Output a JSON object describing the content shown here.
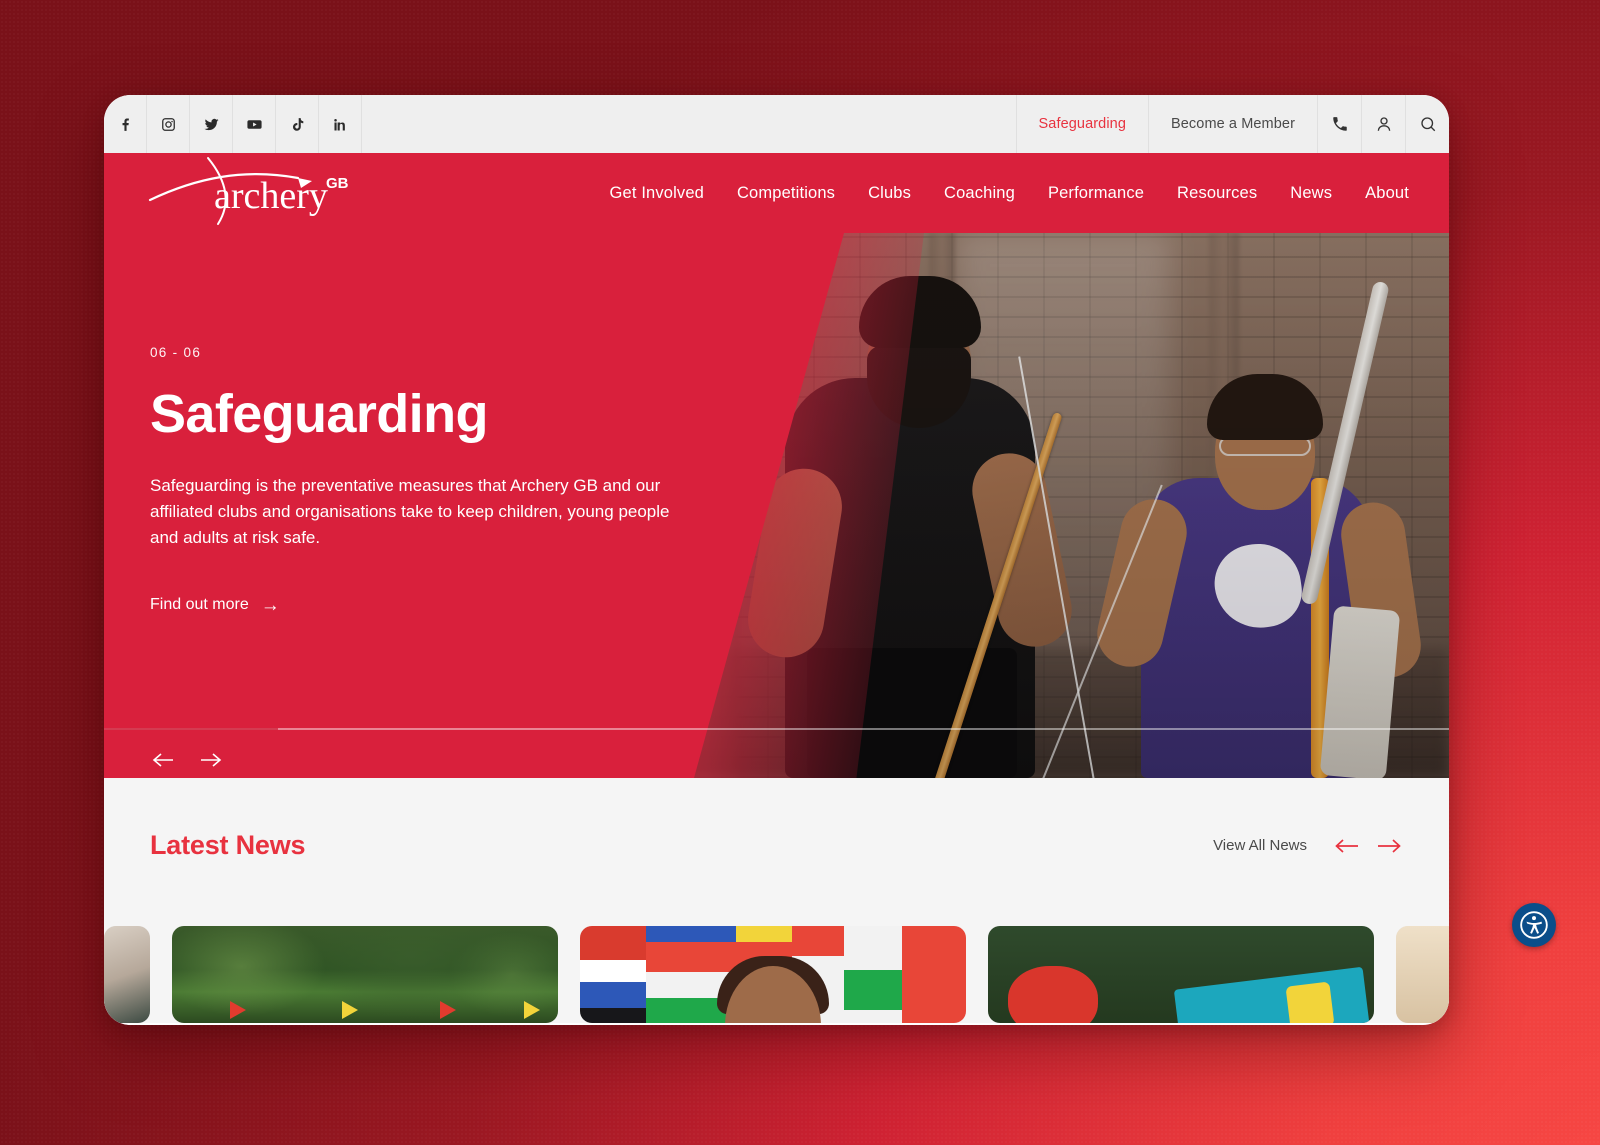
{
  "utility_bar": {
    "social": [
      {
        "name": "facebook-icon",
        "label": "Facebook"
      },
      {
        "name": "instagram-icon",
        "label": "Instagram"
      },
      {
        "name": "twitter-icon",
        "label": "Twitter"
      },
      {
        "name": "youtube-icon",
        "label": "YouTube"
      },
      {
        "name": "tiktok-icon",
        "label": "TikTok"
      },
      {
        "name": "linkedin-icon",
        "label": "LinkedIn"
      }
    ],
    "safeguarding_label": "Safeguarding",
    "become_member_label": "Become a Member",
    "phone_icon": "phone-icon",
    "account_icon": "account-icon",
    "search_icon": "search-icon"
  },
  "brand": {
    "logo_text": "archery",
    "logo_sup": "GB",
    "primary_red": "#d9203c",
    "accent_red": "#e8323f"
  },
  "main_nav": {
    "items": [
      {
        "label": "Get Involved"
      },
      {
        "label": "Competitions"
      },
      {
        "label": "Clubs"
      },
      {
        "label": "Coaching"
      },
      {
        "label": "Performance"
      },
      {
        "label": "Resources"
      },
      {
        "label": "News"
      },
      {
        "label": "About"
      }
    ]
  },
  "hero": {
    "counter": "06 - 06",
    "title": "Safeguarding",
    "description": "Safeguarding is the preventative measures that Archery GB and our affiliated clubs and organisations take to keep children, young people and adults at risk safe.",
    "cta_label": "Find out more",
    "cta_arrow": "→",
    "prev_icon": "arrow-left-icon",
    "next_icon": "arrow-right-icon"
  },
  "news": {
    "title": "Latest News",
    "view_all_label": "View All News",
    "prev_icon": "arrow-left-icon",
    "next_icon": "arrow-right-icon",
    "cards": [
      {
        "alt": "indoor-range-photo"
      },
      {
        "alt": "outdoor-field-with-flags-photo"
      },
      {
        "alt": "young-archer-in-front-of-flags-photo"
      },
      {
        "alt": "world-archery-youth-banner-photo"
      },
      {
        "alt": "partial-photo"
      }
    ]
  },
  "accessibility": {
    "widget_icon": "accessibility-icon",
    "color": "#0b4e8a"
  }
}
